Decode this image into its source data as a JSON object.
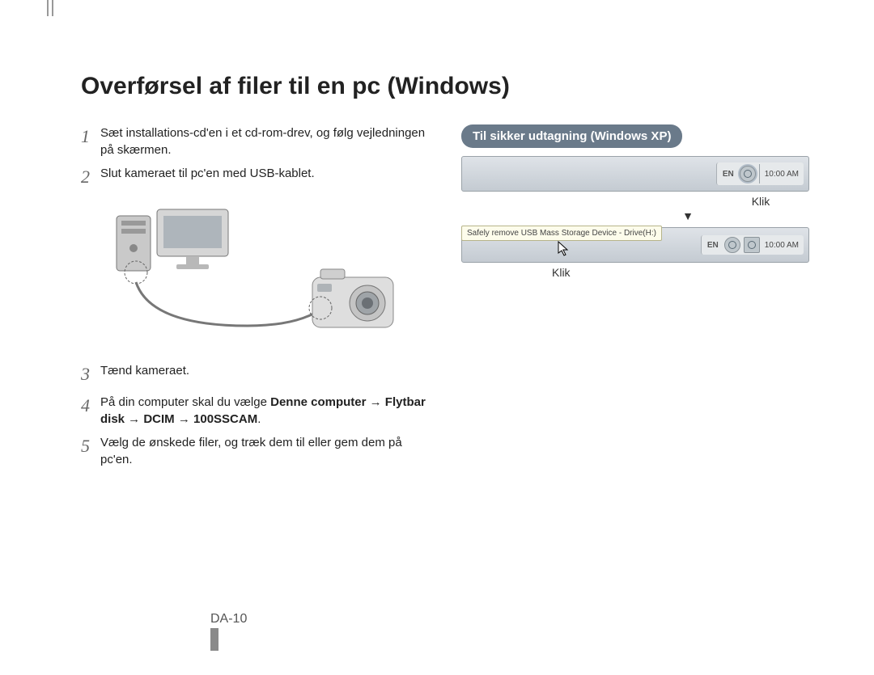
{
  "title": "Overførsel af filer til en pc (Windows)",
  "steps": {
    "s1": {
      "num": "1",
      "text": "Sæt installations-cd'en i et cd-rom-drev, og følg vejledningen på skærmen."
    },
    "s2": {
      "num": "2",
      "text": "Slut kameraet til pc'en med USB-kablet."
    },
    "s3": {
      "num": "3",
      "text": "Tænd kameraet."
    },
    "s4": {
      "num": "4",
      "prefix": "På din computer skal du vælge ",
      "bold": "Denne computer → Flytbar disk → DCIM → 100SSCAM",
      "suffix": "."
    },
    "s5": {
      "num": "5",
      "text": "Vælg de ønskede filer, og træk dem til eller gem dem på pc'en."
    }
  },
  "callout": {
    "header": "Til sikker udtagning (Windows XP)",
    "klik1": "Klik",
    "arrow": "▼",
    "balloon": "Safely remove USB Mass Storage Device - Drive(H:)",
    "klik2": "Klik",
    "tray": {
      "lang": "EN",
      "time": "10:00 AM"
    }
  },
  "pageNumber": "DA-10",
  "icons": {
    "safeRemove": "safe-remove-icon",
    "speaker": "speaker-icon"
  }
}
